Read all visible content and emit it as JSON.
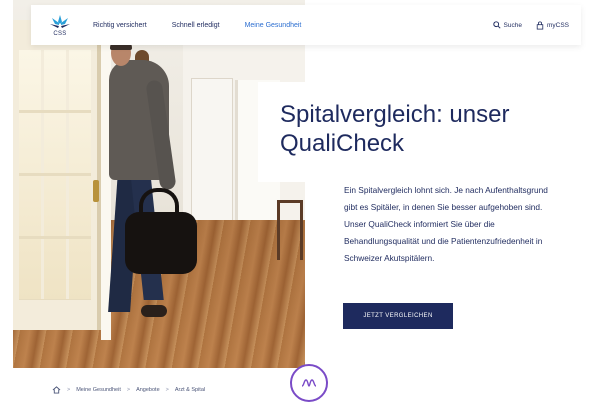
{
  "header": {
    "logo_text": "CSS",
    "nav": [
      {
        "label": "Richtig versichert",
        "active": false
      },
      {
        "label": "Schnell erledigt",
        "active": false
      },
      {
        "label": "Meine Gesundheit",
        "active": true
      }
    ],
    "search_label": "Suche",
    "account_label": "myCSS"
  },
  "hero": {
    "title": "Spitalvergleich: unser QualiCheck",
    "body": "Ein Spitalvergleich lohnt sich. Je nach Aufenthaltsgrund gibt es Spitäler, in denen Sie besser aufgehoben sind. Unser QualiCheck informiert Sie über die Behandlungsqualität und die Patientenzufriedenheit in Schweizer Akutspitälern.",
    "cta_label": "JETZT VERGLEICHEN"
  },
  "breadcrumb": {
    "items": [
      "Meine Gesundheit",
      "Angebote",
      "Arzt & Spital"
    ],
    "separator": ">"
  },
  "colors": {
    "brand_navy": "#1e2a5e",
    "nav_active": "#2d6fd1",
    "accent_purple": "#7a4bc7",
    "logo_teal": "#2a9fd8"
  },
  "icons": {
    "home": "home-icon",
    "search": "search-icon",
    "account": "lock-icon",
    "wave": "wave-icon"
  }
}
